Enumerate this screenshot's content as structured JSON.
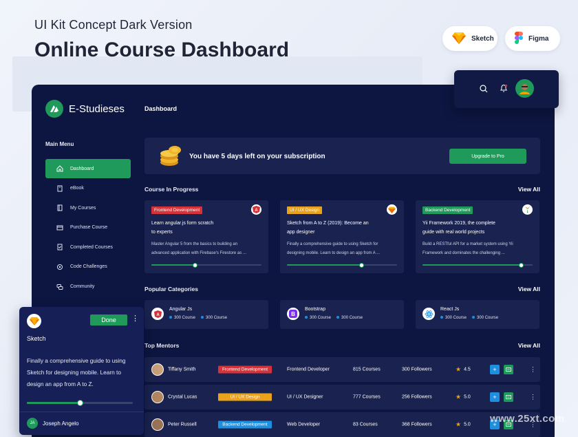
{
  "header": {
    "subtitle": "UI Kit Concept Dark Version",
    "title": "Online Course Dashboard"
  },
  "tools": {
    "sketch_label": "Sketch",
    "figma_label": "Figma"
  },
  "app": {
    "brand": "E-Studieses",
    "breadcrumb": "Dashboard"
  },
  "sidebar": {
    "heading": "Main Menu",
    "items": [
      {
        "label": "Dashboard",
        "icon": "home-icon"
      },
      {
        "label": "eBook",
        "icon": "book-icon"
      },
      {
        "label": "My Courses",
        "icon": "courses-icon"
      },
      {
        "label": "Purchase Course",
        "icon": "purchase-icon"
      },
      {
        "label": "Completed Courses",
        "icon": "completed-icon"
      },
      {
        "label": "Code Challenges",
        "icon": "code-challenge-icon"
      },
      {
        "label": "Community",
        "icon": "community-icon"
      }
    ]
  },
  "subscription": {
    "message": "You have 5 days left on your subscription",
    "button": "Upgrade to Pro"
  },
  "courses": {
    "heading": "Course In Progress",
    "view_all": "View All",
    "items": [
      {
        "tag": "Frontend Development",
        "line1": "Learn angular.js form scratch",
        "line2": "to experts",
        "desc1": "Master Angular 5 from the basics to building an",
        "desc2": "advanced application with Firebase's Firestore as ...",
        "progress": 0.4,
        "icon": "angular-icon"
      },
      {
        "tag": "UI / UX Design",
        "line1": "Sketch from A to Z (2019): Become an",
        "line2": "app designer",
        "desc1": "Finally a comprehensive guide to using Sketch for",
        "desc2": "designing mobile. Learn to design an app from A ...",
        "progress": 0.68,
        "icon": "sketch-icon"
      },
      {
        "tag": "Backend Development",
        "line1": "Yii Framework 2019, the complete",
        "line2": "guide with real world projects",
        "desc1": "Build a RESTful API for a market system using Yii",
        "desc2": "Framework and dominates the challenging ...",
        "progress": 0.9,
        "icon": "yii-icon"
      }
    ]
  },
  "categories": {
    "heading": "Popular Categories",
    "view_all": "View All",
    "items": [
      {
        "name": "Angular Js",
        "a": "300 Course",
        "b": "300 Course",
        "icon": "angular-icon"
      },
      {
        "name": "Bootstrap",
        "a": "300 Course",
        "b": "300 Course",
        "icon": "bootstrap-icon"
      },
      {
        "name": "React Js",
        "a": "300 Course",
        "b": "300 Course",
        "icon": "react-icon"
      }
    ]
  },
  "mentors": {
    "heading": "Top Mentors",
    "view_all": "View All",
    "items": [
      {
        "name": "Tiffany Smith",
        "tag": "Frontend Development",
        "role": "Frontend Developer",
        "courses": "815 Courses",
        "followers": "300 Followers",
        "rating": "4.5"
      },
      {
        "name": "Crystal Lucas",
        "tag": "UI / UX Design",
        "role": "UI / UX Designer",
        "courses": "777 Courses",
        "followers": "256 Followers",
        "rating": "5.0"
      },
      {
        "name": "Peter Russell",
        "tag": "Backend Development",
        "role": "Web Developer",
        "courses": "83 Courses",
        "followers": "368 Followers",
        "rating": "5.0"
      }
    ]
  },
  "popup": {
    "done": "Done",
    "title": "Sketch",
    "desc": "Finally a comprehensive guide to using Sketch for designing mobile. Learn to design an app from A to Z.",
    "progress": 0.5,
    "user_initials": "JA",
    "user_name": "Joseph Angelo"
  },
  "watermark": "www.25xt.com",
  "colors": {
    "panel": "#0d1640",
    "card": "#1a2350",
    "accent": "#1f9a5b",
    "red": "#d5323a",
    "yellow": "#e8a21c",
    "blue": "#1c8fe0"
  }
}
